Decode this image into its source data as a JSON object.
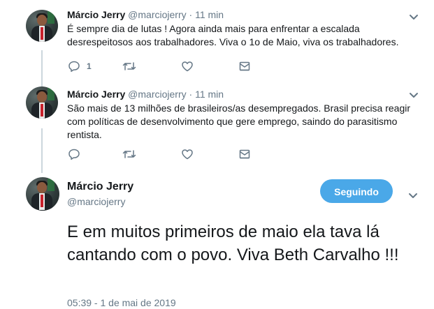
{
  "tweets": [
    {
      "name": "Márcio Jerry",
      "handle": "@marciojerry",
      "separator": "·",
      "time": "11 min",
      "text": "É sempre dia de lutas ! Agora ainda mais para enfrentar a escalada desrespeitosos aos trabalhadores. Viva o 1o de Maio, viva os trabalhadores.",
      "reply_count": "1"
    },
    {
      "name": "Márcio Jerry",
      "handle": "@marciojerry",
      "separator": "·",
      "time": "11 min",
      "text": "São mais de 13 milhões de brasileiros/as desempregados. Brasil precisa reagir com políticas de desenvolvimento que gere emprego, saindo do parasitismo rentista.",
      "reply_count": ""
    }
  ],
  "main_tweet": {
    "name": "Márcio Jerry",
    "handle": "@marciojerry",
    "follow_label": "Seguindo",
    "text": "E em muitos primeiros de maio ela tava lá cantando com o povo. Viva Beth Carvalho !!!",
    "timestamp": "05:39 - 1 de mai de 2019"
  },
  "icons": {
    "reply": "reply-icon",
    "retweet": "retweet-icon",
    "like": "heart-icon",
    "message": "envelope-icon",
    "caret": "chevron-down-icon"
  },
  "colors": {
    "accent": "#4aa8e8",
    "muted": "#657786",
    "text": "#14171a",
    "thread_line": "#ccd6dd"
  }
}
